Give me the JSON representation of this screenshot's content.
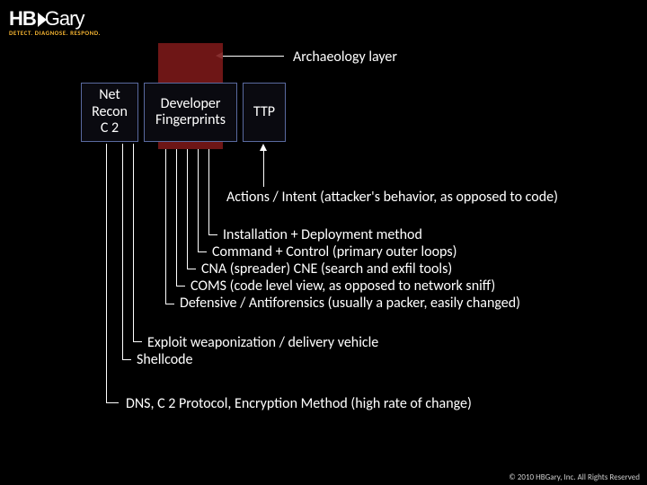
{
  "logo": {
    "main": "HB",
    "main2": "Gary",
    "sub": "DETECT. DIAGNOSE. RESPOND."
  },
  "labels": {
    "archaeology": "Archaeology layer",
    "actions_intent": "Actions / Intent (attacker's behavior, as opposed to code)",
    "dns_line": "DNS, C 2 Protocol, Encryption Method (high rate of change)"
  },
  "boxes": {
    "net_recon": "Net\nRecon\nC 2",
    "dev_fp": "Developer\nFingerprints",
    "ttp": "TTP"
  },
  "list": {
    "l1": "Installation + Deployment method",
    "l2": "Command + Control (primary outer loops)",
    "l3": "CNA (spreader) CNE (search and exfil tools)",
    "l4": "COMS (code level view, as opposed to network sniff)",
    "l5": "Defensive / Antiforensics (usually a packer, easily changed)",
    "l6": "Exploit weaponization / delivery vehicle",
    "l7": "Shellcode"
  },
  "footer": {
    "copyright": "© 2010 HBGary, Inc. All Rights Reserved"
  }
}
